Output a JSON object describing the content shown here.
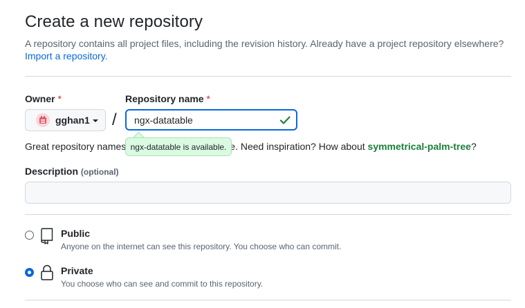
{
  "header": {
    "title": "Create a new repository",
    "subtitle": "A repository contains all project files, including the revision history. Already have a project repository elsewhere?",
    "import_link": "Import a repository."
  },
  "owner": {
    "label": "Owner",
    "required_marker": "*",
    "value": "gghan1",
    "avatar_icon": "owner-avatar-icon"
  },
  "repo": {
    "label": "Repository name",
    "required_marker": "*",
    "value": "ngx-datatable",
    "separator": "/",
    "available_tooltip": "ngx-datatable is available."
  },
  "naming_hint": {
    "prefix": "Great repository names",
    "middle": "e. Need inspiration? How about",
    "suggestion": "symmetrical-palm-tree",
    "suffix": "?"
  },
  "description": {
    "label": "Description",
    "optional": "(optional)",
    "value": ""
  },
  "visibility": {
    "selected": "Private",
    "options": [
      {
        "title": "Public",
        "desc": "Anyone on the internet can see this repository. You choose who can commit.",
        "icon": "repo-icon"
      },
      {
        "title": "Private",
        "desc": "You choose who can see and commit to this repository.",
        "icon": "lock-icon"
      }
    ]
  },
  "colors": {
    "accent": "#0969da",
    "success": "#1a7f37",
    "danger": "#d1242f",
    "muted": "#59636e"
  }
}
